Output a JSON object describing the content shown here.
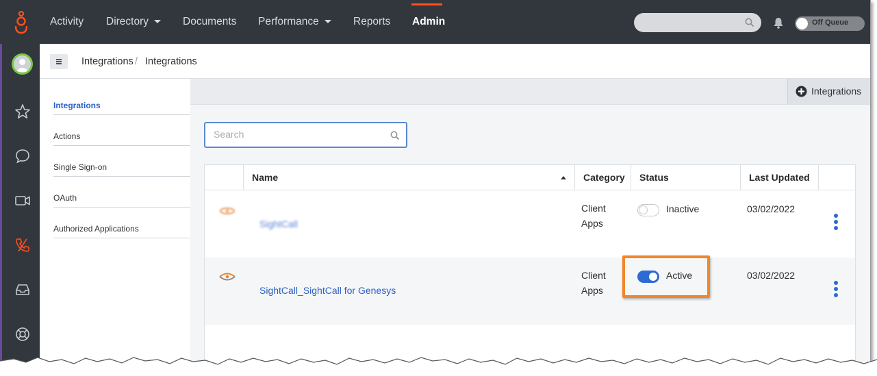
{
  "nav": {
    "items": [
      {
        "label": "Activity",
        "caret": false
      },
      {
        "label": "Directory",
        "caret": true
      },
      {
        "label": "Documents",
        "caret": false
      },
      {
        "label": "Performance",
        "caret": true
      },
      {
        "label": "Reports",
        "caret": false
      },
      {
        "label": "Admin",
        "caret": false,
        "active": true
      }
    ],
    "queue_label": "Off Queue"
  },
  "rail_icons": [
    "star-icon",
    "chat-icon",
    "video-icon",
    "phone-icon",
    "inbox-icon",
    "help-icon"
  ],
  "breadcrumb": [
    "Integrations",
    "Integrations"
  ],
  "subnav": [
    "Integrations",
    "Actions",
    "Single Sign-on",
    "OAuth",
    "Authorized Applications"
  ],
  "toolbar": {
    "add_label": "Integrations"
  },
  "search": {
    "placeholder": "Search"
  },
  "table": {
    "headers": [
      "Name",
      "Category",
      "Status",
      "Last Updated"
    ],
    "rows": [
      {
        "name": "SightCall",
        "category": [
          "Client",
          "Apps"
        ],
        "status": "Inactive",
        "active": false,
        "updated": "03/02/2022"
      },
      {
        "name": "SightCall_SightCall for Genesys",
        "category": [
          "Client",
          "Apps"
        ],
        "status": "Active",
        "active": true,
        "updated": "03/02/2022"
      }
    ]
  },
  "colors": {
    "accent": "#2d6bd4",
    "nav_bg": "#32373d",
    "highlight": "#f2862a",
    "brand": "#ff4f1f"
  }
}
